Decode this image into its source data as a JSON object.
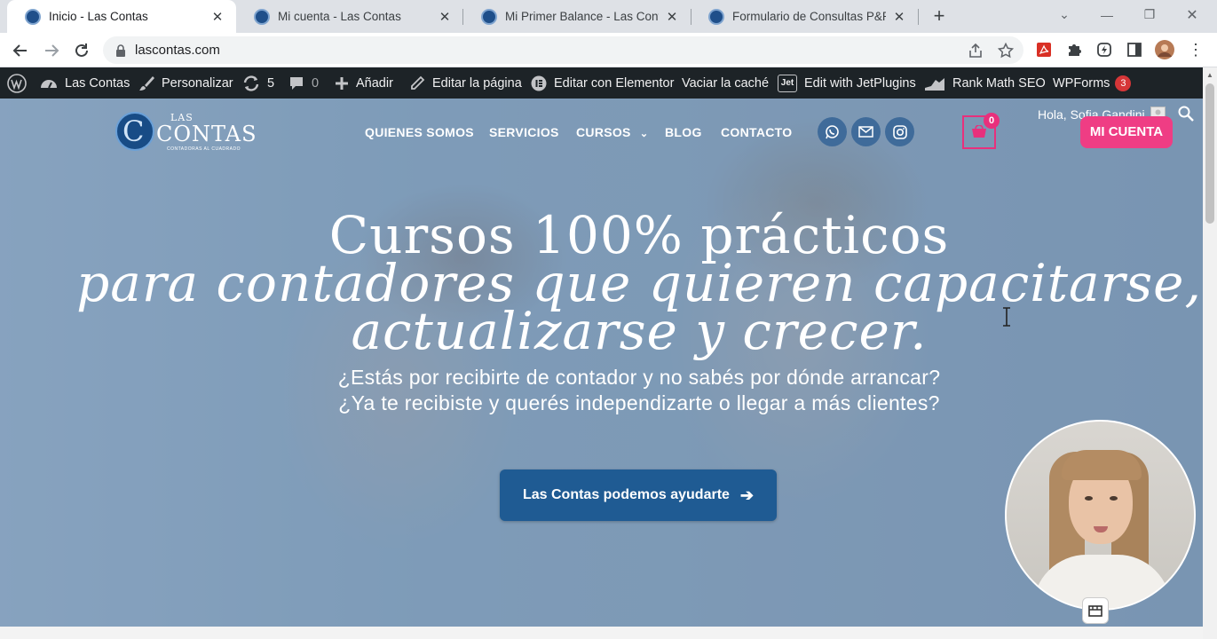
{
  "browser": {
    "tabs": [
      {
        "title": "Inicio - Las Contas",
        "active": true
      },
      {
        "title": "Mi cuenta - Las Contas",
        "active": false
      },
      {
        "title": "Mi Primer Balance - Las Contas",
        "active": false
      },
      {
        "title": "Formulario de Consultas P&R - L",
        "active": false
      }
    ],
    "url": "lascontas.com"
  },
  "adminbar": {
    "site_name": "Las Contas",
    "customize": "Personalizar",
    "updates_count": "5",
    "comments_count": "0",
    "add_new": "Añadir",
    "edit_page": "Editar la página",
    "edit_elementor": "Editar con Elementor",
    "clear_cache": "Vaciar la caché",
    "jetplugins": "Edit with JetPlugins",
    "rankmath": "Rank Math SEO",
    "wpforms": "WPForms",
    "wpforms_badge": "3",
    "jet_icon_text": "Jet"
  },
  "site": {
    "logo": {
      "top": "LAS",
      "main": "CONTAS",
      "tagline": "CONTADORAS AL CUADRADO"
    },
    "nav": [
      "QUIENES SOMOS",
      "SERVICIOS",
      "CURSOS",
      "BLOG",
      "CONTACTO"
    ],
    "cart_count": "0",
    "greeting": "Hola, Sofia Gandini",
    "account_button": "MI CUENTA"
  },
  "hero": {
    "line1": "Cursos 100% prácticos",
    "line2": "para contadores que quieren capacitarse,",
    "line3": "actualizarse y crecer.",
    "sub1": "¿Estás por recibirte de contador y no sabés por dónde arrancar?",
    "sub2": "¿Ya te recibiste y querés independizarte o llegar a más clientes?",
    "cta": "Las Contas podemos ayudarte"
  },
  "colors": {
    "accent_pink": "#ef3d84",
    "brand_blue": "#1f5b93",
    "admin_bar": "#1d2327"
  },
  "icons": [
    "wordpress-icon",
    "dashboard-icon",
    "brush-icon",
    "refresh-icon",
    "comment-icon",
    "plus-icon",
    "pencil-icon",
    "elementor-icon",
    "jet-icon",
    "rankmath-icon",
    "whatsapp-icon",
    "mail-icon",
    "instagram-icon",
    "cart-icon",
    "search-icon",
    "arrow-right-icon",
    "camera-icon"
  ]
}
